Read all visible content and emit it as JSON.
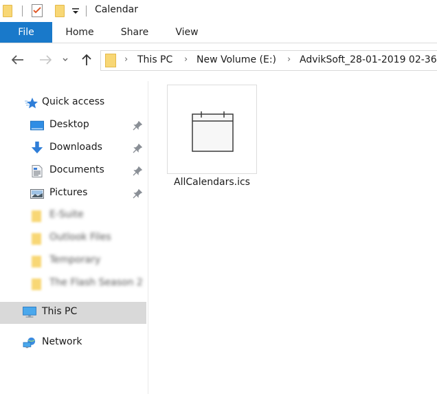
{
  "window": {
    "title": "Calendar"
  },
  "quick_access_toolbar": {
    "icons": [
      "folder-icon",
      "properties-check-icon",
      "new-folder-icon",
      "customize-dropdown-icon"
    ]
  },
  "ribbon": {
    "tabs": [
      {
        "label": "File",
        "active": true
      },
      {
        "label": "Home"
      },
      {
        "label": "Share"
      },
      {
        "label": "View"
      }
    ],
    "accent_color": "#1979ca"
  },
  "navigation": {
    "back_icon": "arrow-left-icon",
    "forward_icon": "arrow-right-icon",
    "recent_icon": "chevron-down-icon",
    "up_icon": "arrow-up-icon",
    "breadcrumb": [
      "This PC",
      "New Volume (E:)",
      "AdvikSoft_28-01-2019 02-36"
    ]
  },
  "sidebar": {
    "quick_access": {
      "label": "Quick access",
      "items": [
        {
          "label": "Desktop",
          "icon": "desktop-icon",
          "pinned": true
        },
        {
          "label": "Downloads",
          "icon": "downloads-icon",
          "pinned": true
        },
        {
          "label": "Documents",
          "icon": "documents-icon",
          "pinned": true
        },
        {
          "label": "Pictures",
          "icon": "pictures-icon",
          "pinned": true
        },
        {
          "label": "E-Suite",
          "icon": "folder-icon",
          "blurred": true
        },
        {
          "label": "Outlook Files",
          "icon": "folder-icon",
          "blurred": true
        },
        {
          "label": "Temporary",
          "icon": "folder-icon",
          "blurred": true
        },
        {
          "label": "The Flash Season 2",
          "icon": "folder-icon",
          "blurred": true
        }
      ]
    },
    "this_pc": {
      "label": "This PC",
      "selected": true
    },
    "network": {
      "label": "Network"
    }
  },
  "content": {
    "files": [
      {
        "name": "AllCalendars.ics",
        "icon": "calendar-file-icon"
      }
    ]
  }
}
